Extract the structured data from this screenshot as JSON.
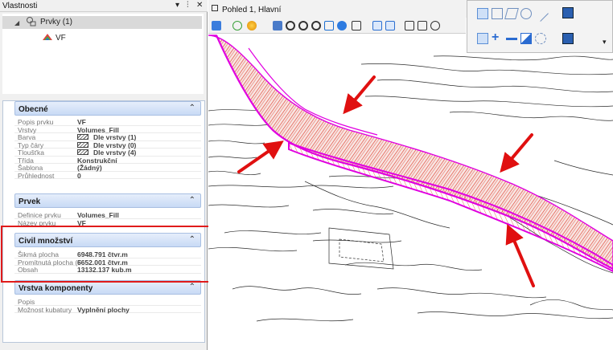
{
  "panel": {
    "title": "Vlastnosti",
    "buttons": {
      "dropdown": "▾",
      "pin": "⫶",
      "close": "✕"
    },
    "tree": {
      "root": {
        "label": "Prvky (1)",
        "toggle": "◢"
      },
      "child": {
        "label": "VF"
      }
    },
    "sections": [
      {
        "title": "Obecné",
        "rows": [
          {
            "label": "Popis prvku",
            "value": "VF"
          },
          {
            "label": "Vrstvy",
            "value": "Volumes_Fill"
          },
          {
            "label": "Barva",
            "value": "Dle vrstvy (1)",
            "swatch": true
          },
          {
            "label": "Typ čáry",
            "value": "Dle vrstvy (0)",
            "swatch": true
          },
          {
            "label": "Tloušťka",
            "value": "Dle vrstvy (4)",
            "swatch": true
          },
          {
            "label": "Třída",
            "value": "Konstrukční"
          },
          {
            "label": "Šablona",
            "value": "(Žádný)"
          },
          {
            "label": "Průhlednost",
            "value": "0"
          }
        ]
      },
      {
        "title": "Prvek",
        "rows": [
          {
            "label": "Definice prvku",
            "value": "Volumes_Fill"
          },
          {
            "label": "Název prvku",
            "value": "VF"
          }
        ]
      },
      {
        "title": "Civil množství",
        "rows": [
          {
            "label": "Šikmá plocha",
            "value": "6948.791 čtvr.m"
          },
          {
            "label": "Promítnutá plocha (F",
            "value": "6652.001 čtvr.m"
          },
          {
            "label": "Obsah",
            "value": "13132.137 kub.m"
          }
        ]
      },
      {
        "title": "Vrstva komponenty",
        "rows": [
          {
            "label": "Popis",
            "value": ""
          },
          {
            "label": "Možnost kubatury",
            "value": "Vyplnění plochy"
          }
        ]
      }
    ],
    "chevron": "⌃"
  },
  "view": {
    "title": "Pohled 1, Hlavní"
  },
  "colors": {
    "highlight": "#e01b1b",
    "fill_hatch": "#e0483a",
    "boundary": "#e000e0",
    "arrow": "#e01010",
    "section_head": "#c8daf5"
  }
}
